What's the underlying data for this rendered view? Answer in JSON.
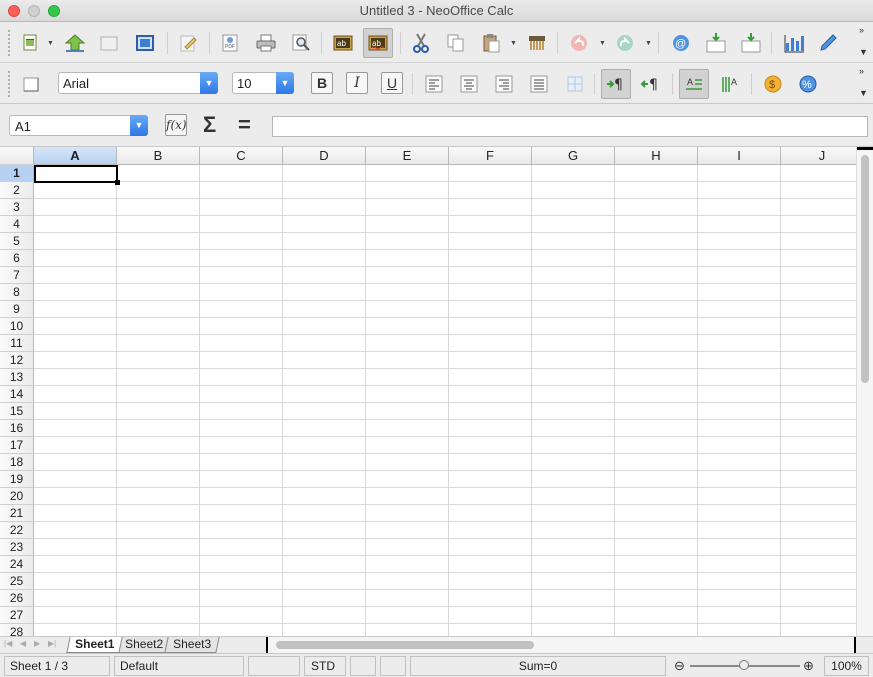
{
  "window": {
    "title": "Untitled 3 - NeoOffice Calc"
  },
  "toolbar_standard": {
    "buttons": [
      {
        "name": "new-document-icon"
      },
      {
        "name": "open-document-icon"
      },
      {
        "name": "save-document-icon"
      },
      {
        "name": "document-as-email-icon"
      },
      {
        "name": "edit-file-icon"
      },
      {
        "name": "export-pdf-icon"
      },
      {
        "name": "print-icon"
      },
      {
        "name": "page-preview-icon"
      },
      {
        "name": "spellcheck-icon"
      },
      {
        "name": "autospellcheck-icon"
      },
      {
        "name": "cut-icon"
      },
      {
        "name": "copy-icon"
      },
      {
        "name": "paste-icon"
      },
      {
        "name": "clone-formatting-icon"
      },
      {
        "name": "undo-icon"
      },
      {
        "name": "redo-icon"
      },
      {
        "name": "hyperlink-icon"
      },
      {
        "name": "sort-ascending-icon"
      },
      {
        "name": "sort-descending-icon"
      },
      {
        "name": "chart-icon"
      },
      {
        "name": "show-draw-functions-icon"
      }
    ],
    "sort_asc_label": "A-Z",
    "sort_desc_label": "Z-A"
  },
  "toolbar_formatting": {
    "font_name": "Arial",
    "font_size": "10",
    "bold_label": "B",
    "italic_label": "I",
    "underline_label": "U"
  },
  "formula_bar": {
    "name_box": "A1",
    "fx_label": "f(x)",
    "sum_label": "Σ",
    "equals_label": "=",
    "content": ""
  },
  "grid": {
    "columns": [
      "A",
      "B",
      "C",
      "D",
      "E",
      "F",
      "G",
      "H",
      "I",
      "J"
    ],
    "rows": [
      "1",
      "2",
      "3",
      "4",
      "5",
      "6",
      "7",
      "8",
      "9",
      "10",
      "11",
      "12",
      "13",
      "14",
      "15",
      "16",
      "17",
      "18",
      "19",
      "20",
      "21",
      "22",
      "23",
      "24",
      "25",
      "26",
      "27",
      "28"
    ],
    "active_cell": "A1"
  },
  "sheet_tabs": [
    {
      "label": "Sheet1",
      "active": true
    },
    {
      "label": "Sheet2",
      "active": false
    },
    {
      "label": "Sheet3",
      "active": false
    }
  ],
  "status_bar": {
    "sheet": "Sheet 1 / 3",
    "page_style": "Default",
    "mode": "STD",
    "sum": "Sum=0",
    "zoom": "100%"
  },
  "colors": {
    "accent": "#2c78e6",
    "selected_header": "#b7d1f2"
  }
}
